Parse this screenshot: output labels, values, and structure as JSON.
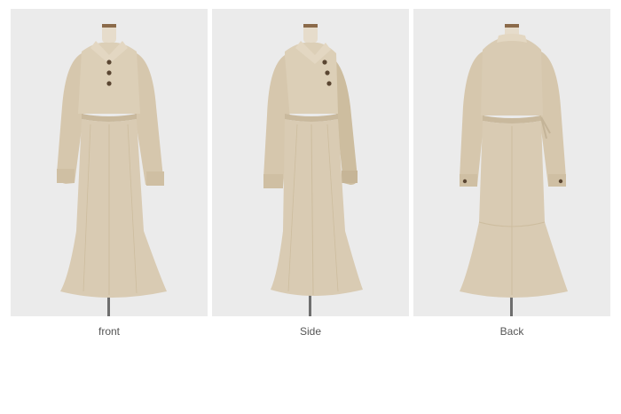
{
  "gallery": {
    "views": [
      {
        "label": "front",
        "image": "beige-shirt-dress-front-photo"
      },
      {
        "label": "Side",
        "image": "beige-shirt-dress-side-photo"
      },
      {
        "label": "Back",
        "image": "beige-shirt-dress-back-photo"
      }
    ]
  },
  "colors": {
    "background": "#ebebeb",
    "dress": "#d9cbb3",
    "dress_shadow": "#c4b498",
    "buttons": "#5a4632",
    "caption": "#555555"
  }
}
